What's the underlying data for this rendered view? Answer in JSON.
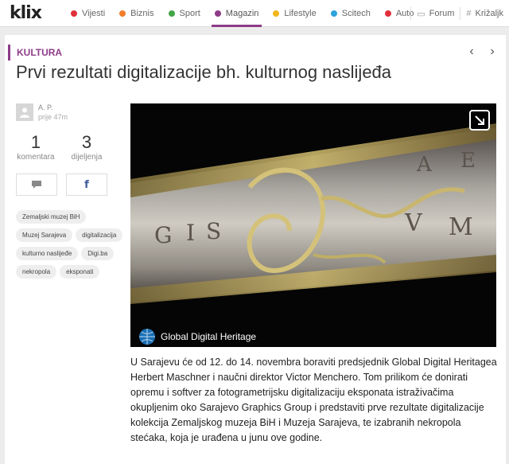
{
  "site": {
    "logo": "klix"
  },
  "nav": {
    "items": [
      {
        "label": "Vijesti",
        "color": "#e0303a"
      },
      {
        "label": "Biznis",
        "color": "#f07d2a"
      },
      {
        "label": "Sport",
        "color": "#44a548"
      },
      {
        "label": "Magazin",
        "color": "#8e3c88",
        "active": true
      },
      {
        "label": "Lifestyle",
        "color": "#f0b71e"
      },
      {
        "label": "Scitech",
        "color": "#2fa3dc"
      },
      {
        "label": "Auto",
        "color": "#e0303a"
      }
    ],
    "forum_label": "Forum",
    "krizaljka_label": "Križaljk"
  },
  "article": {
    "section": "KULTURA",
    "title": "Prvi rezultati digitalizacije bh. kulturnog naslijeđa",
    "author": "A. P.",
    "time": "prije 47m",
    "comments_count": "1",
    "comments_label": "komentara",
    "shares_count": "3",
    "shares_label": "dijeljenja",
    "share_button_label": "f",
    "image_caption_logo": "Global Digital Heritage",
    "image_letters": [
      "G",
      "I",
      "S",
      "V",
      "M",
      "A",
      "E"
    ],
    "tags": [
      "Zemaljski muzej BiH",
      "Muzej Sarajeva",
      "digitalizacija",
      "kulturno naslijeđe",
      "Digi.ba",
      "nekropola",
      "eksponati"
    ],
    "body": "U Sarajevu će od 12. do 14. novembra boraviti predsjednik Global Digital Heritagea Herbert Maschner i naučni direktor Victor Menchero. Tom prilikom će donirati opremu i softver za fotogrametrijsku digitalizaciju eksponata istraživačima okupljenim oko Sarajevo Graphics Group i predstaviti prve rezultate digitalizacije kolekcija Zemaljskog muzeja BiH i Muzeja Sarajeva, te izabranih nekropola stećaka, koja je urađena u junu ove godine."
  },
  "colors": {
    "accent": "#8e3c88"
  }
}
